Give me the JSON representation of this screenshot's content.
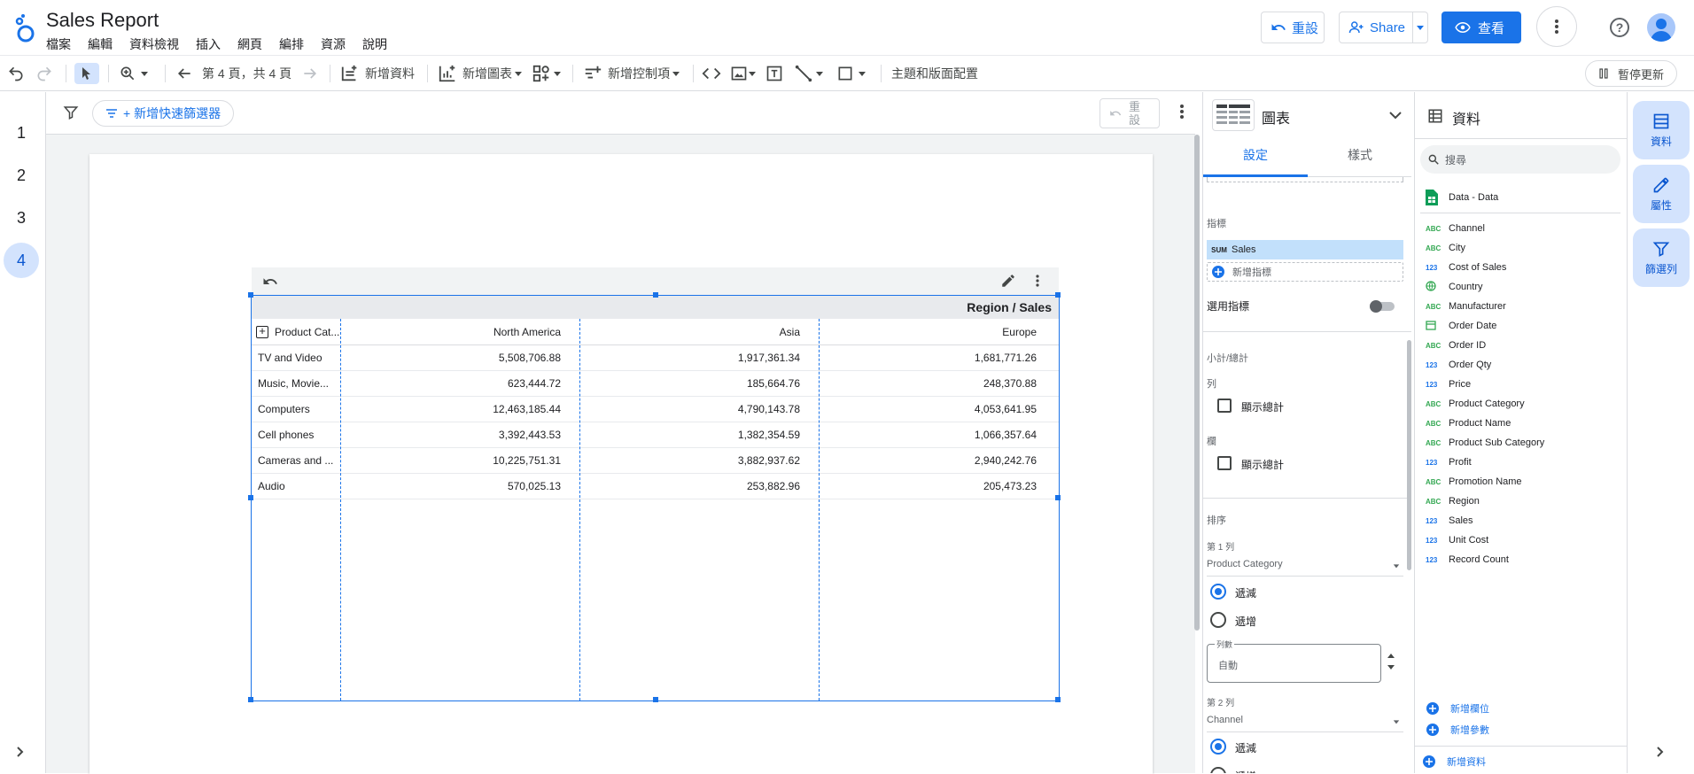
{
  "app": {
    "title": "Sales Report",
    "menu": [
      "檔案",
      "編輯",
      "資料檢視",
      "插入",
      "網頁",
      "編排",
      "資源",
      "說明"
    ],
    "reset_label": "重設",
    "share_label": "Share",
    "view_label": "查看"
  },
  "toolbar": {
    "page_label": "第 4 頁，共 4 頁",
    "add_data": "新增資料",
    "add_chart": "新增圖表",
    "add_control": "新增控制項",
    "theme_layout": "主題和版面配置",
    "pause_updates": "暫停更新"
  },
  "pages": [
    "1",
    "2",
    "3",
    "4"
  ],
  "canvas": {
    "add_filter_label": "+ 新增快速篩選器",
    "reset_label": "重設"
  },
  "table": {
    "title": "Region / Sales",
    "headers": [
      "Product Cat...",
      "North America",
      "Asia",
      "Europe"
    ],
    "rows": [
      [
        "TV and Video",
        "5,508,706.88",
        "1,917,361.34",
        "1,681,771.26"
      ],
      [
        "Music, Movie...",
        "623,444.72",
        "185,664.76",
        "248,370.88"
      ],
      [
        "Computers",
        "12,463,185.44",
        "4,790,143.78",
        "4,053,641.95"
      ],
      [
        "Cell phones",
        "3,392,443.53",
        "1,382,354.59",
        "1,066,357.64"
      ],
      [
        "Cameras and ...",
        "10,225,751.31",
        "3,882,937.62",
        "2,940,242.76"
      ],
      [
        "Audio",
        "570,025.13",
        "253,882.96",
        "205,473.23"
      ]
    ]
  },
  "setup": {
    "panel_title": "圖表",
    "tab_setup": "設定",
    "tab_style": "樣式",
    "metric_section": "指標",
    "metric_agg": "SUM",
    "metric_name": "Sales",
    "add_metric": "新增指標",
    "optional_metric": "選用指標",
    "subtotal_section": "小計/總計",
    "row_label": "列",
    "show_total_row": "顯示總計",
    "col_label": "欄",
    "show_total_col": "顯示總計",
    "sort_section": "排序",
    "sort1_label": "第 1 列",
    "sort1_field": "Product Category",
    "desc": "遞減",
    "asc": "遞增",
    "count_label": "列數",
    "count_value": "自動",
    "sort2_label": "第 2 列",
    "sort2_field": "Channel",
    "desc2": "遞減",
    "asc2": "遞增"
  },
  "data_panel": {
    "title": "資料",
    "search_placeholder": "搜尋",
    "source": "Data - Data",
    "fields": [
      {
        "type": "ABC",
        "name": "Channel"
      },
      {
        "type": "ABC",
        "name": "City"
      },
      {
        "type": "123",
        "name": "Cost of Sales"
      },
      {
        "type": "geo",
        "name": "Country"
      },
      {
        "type": "ABC",
        "name": "Manufacturer"
      },
      {
        "type": "date",
        "name": "Order Date"
      },
      {
        "type": "ABC",
        "name": "Order ID"
      },
      {
        "type": "123",
        "name": "Order Qty"
      },
      {
        "type": "123",
        "name": "Price"
      },
      {
        "type": "ABC",
        "name": "Product Category"
      },
      {
        "type": "ABC",
        "name": "Product Name"
      },
      {
        "type": "ABC",
        "name": "Product Sub Category"
      },
      {
        "type": "123",
        "name": "Profit"
      },
      {
        "type": "ABC",
        "name": "Promotion Name"
      },
      {
        "type": "ABC",
        "name": "Region"
      },
      {
        "type": "123",
        "name": "Sales"
      },
      {
        "type": "123",
        "name": "Unit Cost"
      },
      {
        "type": "123",
        "name": "Record Count"
      }
    ],
    "add_field": "新增欄位",
    "add_param": "新增參數",
    "add_data": "新增資料"
  },
  "rail": {
    "data": "資料",
    "properties": "屬性",
    "filter": "篩選列"
  }
}
